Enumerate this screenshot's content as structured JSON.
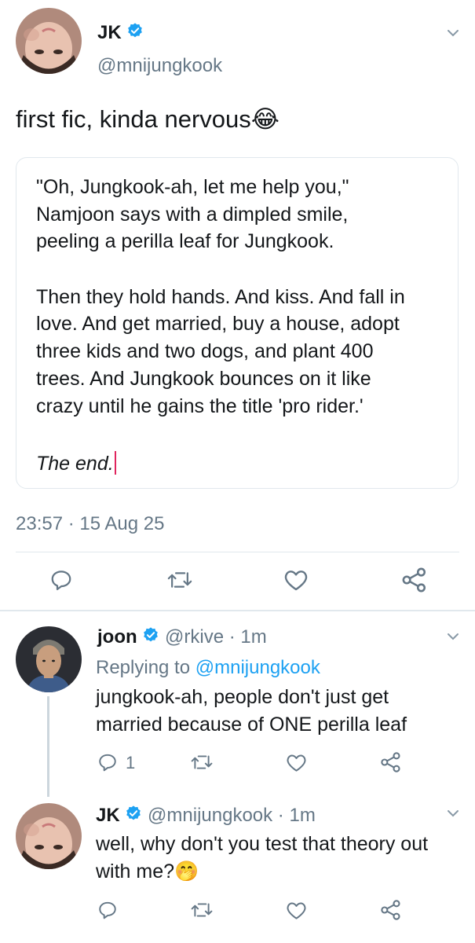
{
  "main_tweet": {
    "display_name": "JK",
    "handle": "@mnijungkook",
    "text": "first fic, kinda nervous",
    "emoji": "😂",
    "quote_lines": [
      "\"Oh, Jungkook-ah, let me help you,\"",
      "Namjoon says with a dimpled smile,",
      "peeling a perilla leaf for Jungkook.",
      "Then they hold hands. And kiss. And fall in",
      "love. And get married, buy a house, adopt",
      "three kids and two dogs, and plant 400",
      "trees. And Jungkook bounces on it like",
      "crazy until he gains the title 'pro rider.'",
      "The end."
    ],
    "timestamp": "23:57 · 15 Aug 25",
    "actions": [
      "reply-icon",
      "retweet-icon",
      "like-icon",
      "share-icon"
    ]
  },
  "reply1": {
    "display_name": "joon",
    "handle_time": "@rkive · 1m",
    "replying_prefix": "Replying to ",
    "replying_handle": "@mnijungkook",
    "text_lines": [
      "jungkook-ah, people don't just get",
      "married because of ONE perilla leaf"
    ],
    "reply_count": "1"
  },
  "reply2": {
    "display_name": "JK",
    "handle_time": "@mnijungkook · 1m",
    "text_lines": [
      "well, why don't you test that theory out",
      "with me?"
    ],
    "emoji": "🤭"
  },
  "colors": {
    "verified": "#1da1f2",
    "link": "#1da1f2",
    "icon_gray": "#657786",
    "cursor": "#e0245e"
  }
}
